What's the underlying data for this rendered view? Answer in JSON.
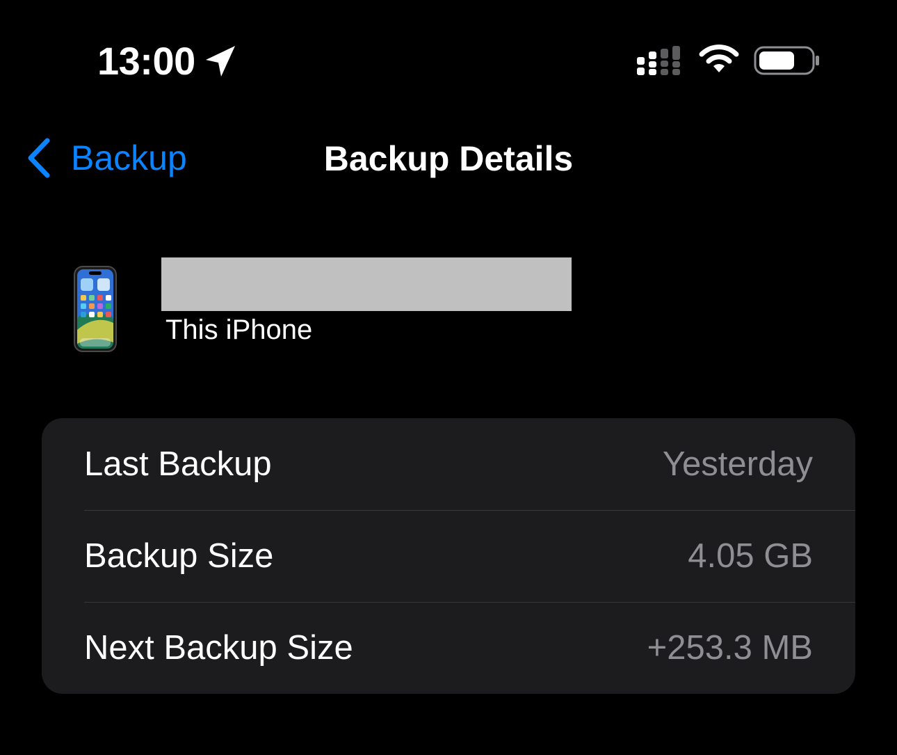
{
  "status_bar": {
    "time": "13:00",
    "icons": [
      "location-arrow-icon",
      "cellular-signal-icon",
      "wifi-icon",
      "battery-icon"
    ]
  },
  "nav": {
    "back_label": "Backup",
    "title": "Backup Details"
  },
  "device": {
    "name": "",
    "subtitle": "This iPhone"
  },
  "details": [
    {
      "label": "Last Backup",
      "value": "Yesterday"
    },
    {
      "label": "Backup Size",
      "value": "4.05 GB"
    },
    {
      "label": "Next Backup Size",
      "value": "+253.3 MB"
    }
  ],
  "colors": {
    "background": "#000000",
    "card": "#1c1c1e",
    "accent": "#0a84ff",
    "secondary_text": "#8e8e93",
    "separator": "#38383a",
    "redaction": "#c0c0c0"
  }
}
